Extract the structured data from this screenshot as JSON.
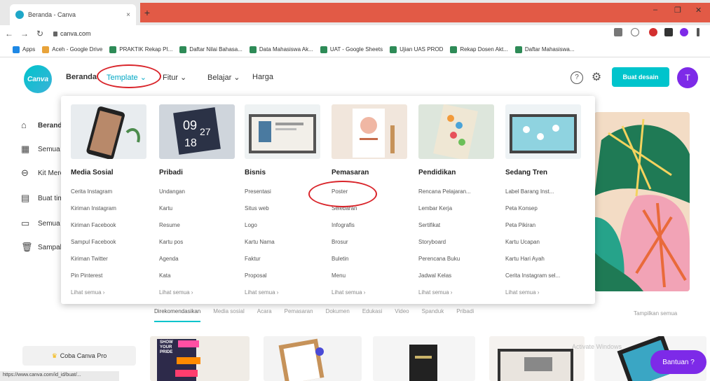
{
  "browser": {
    "tab_title": "Beranda - Canva",
    "tab_close": "×",
    "new_tab": "+",
    "url": "canva.com",
    "controls": {
      "minimize": "–",
      "maximize": "❐",
      "close": "✕"
    },
    "bookmarks": [
      "Apps",
      "Aceh - Google Drive",
      "PRAKTIK Rekap PI...",
      "Daftar Nilai Bahasa...",
      "Data Mahasiswa Ak...",
      "UAT - Google Sheets",
      "Ujian UAS PROD",
      "Rekap Dosen Akt...",
      "Daftar Mahasiswa..."
    ]
  },
  "canva": {
    "logo_text": "Canva",
    "nav": {
      "home": "Beranda",
      "templates": "Template ⌄",
      "features": "Fitur ⌄",
      "learn": "Belajar ⌄",
      "pricing": "Harga"
    },
    "help_icon": "?",
    "settings_icon": "⚙",
    "create_button": "Buat desain",
    "avatar_initial": "T"
  },
  "sidebar": {
    "items": [
      {
        "icon": "⌂",
        "label": "Beranda"
      },
      {
        "icon": "▦",
        "label": "Semua desain"
      },
      {
        "icon": "⊖",
        "label": "Kit Merek"
      },
      {
        "icon": "▤",
        "label": "Buat tim"
      },
      {
        "icon": "▭",
        "label": "Semua folder"
      },
      {
        "icon": "🗑",
        "label": "Sampah"
      }
    ],
    "try_pro": "Coba Canva Pro",
    "crown": "♛"
  },
  "menu": {
    "columns": [
      {
        "title": "Media Sosial",
        "items": [
          "Cerita Instagram",
          "Kiriman Instagram",
          "Kiriman Facebook",
          "Sampul Facebook",
          "Kiriman Twitter",
          "Pin Pinterest"
        ],
        "more": "Lihat semua  ›"
      },
      {
        "title": "Pribadi",
        "items": [
          "Undangan",
          "Kartu",
          "Resume",
          "Kartu pos",
          "Agenda",
          "Kata"
        ],
        "more": "Lihat semua  ›"
      },
      {
        "title": "Bisnis",
        "items": [
          "Presentasi",
          "Situs web",
          "Logo",
          "Kartu Nama",
          "Faktur",
          "Proposal"
        ],
        "more": "Lihat semua  ›"
      },
      {
        "title": "Pemasaran",
        "items": [
          "Poster",
          "Selebaran",
          "Infografis",
          "Brosur",
          "Buletin",
          "Menu"
        ],
        "more": "Lihat semua  ›"
      },
      {
        "title": "Pendidikan",
        "items": [
          "Rencana Pelajaran...",
          "Lembar Kerja",
          "Sertifikat",
          "Storyboard",
          "Perencana Buku",
          "Jadwal Kelas"
        ],
        "more": "Lihat semua  ›"
      },
      {
        "title": "Sedang Tren",
        "items": [
          "Label Barang Inst...",
          "Peta Konsep",
          "Peta Pikiran",
          "Kartu Ucapan",
          "Kartu Hari Ayah",
          "Cerita Instagram sel..."
        ],
        "more": "Lihat semua  ›"
      }
    ]
  },
  "content": {
    "categories": [
      "Direkomendasikan",
      "Media sosial",
      "Acara",
      "Pemasaran",
      "Dokumen",
      "Edukasi",
      "Video",
      "Spanduk",
      "Pribadi"
    ],
    "see_all": "Tampilkan semua",
    "help_button": "Bantuan ?",
    "activate_text": "Activate Windows",
    "thumb_text": "SHOW YOUR PRIDE"
  },
  "status_bar_url": "https://www.canva.com/id_id/buat/..."
}
